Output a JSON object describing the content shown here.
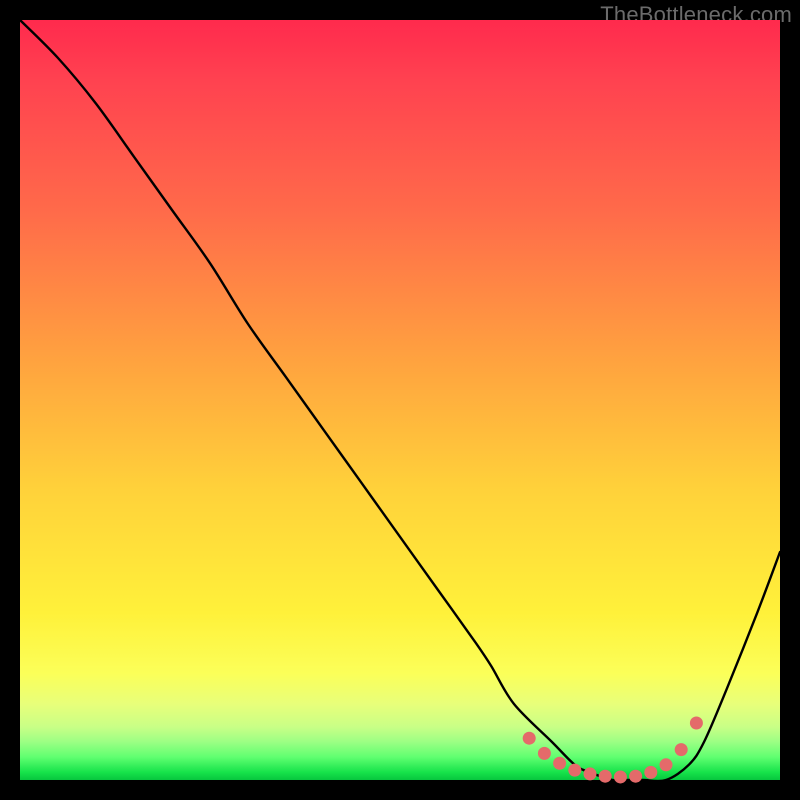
{
  "watermark": "TheBottleneck.com",
  "colors": {
    "curve": "#000000",
    "dots": "#e46a6a",
    "frame": "#000000"
  },
  "chart_data": {
    "type": "line",
    "title": "",
    "xlabel": "",
    "ylabel": "",
    "xlim": [
      0,
      100
    ],
    "ylim": [
      0,
      100
    ],
    "grid": false,
    "legend": false,
    "series": [
      {
        "name": "bottleneck-curve",
        "x": [
          0,
          5,
          10,
          15,
          20,
          25,
          30,
          35,
          40,
          45,
          50,
          55,
          60,
          62,
          65,
          70,
          73,
          75,
          78,
          80,
          82,
          85,
          88,
          90,
          93,
          97,
          100
        ],
        "y": [
          100,
          95,
          89,
          82,
          75,
          68,
          60,
          53,
          46,
          39,
          32,
          25,
          18,
          15,
          10,
          5,
          2,
          1,
          0,
          0,
          0,
          0,
          2,
          5,
          12,
          22,
          30
        ]
      }
    ],
    "highlight_points": {
      "name": "optimal-range-dots",
      "x": [
        67,
        69,
        71,
        73,
        75,
        77,
        79,
        81,
        83,
        85,
        87,
        89
      ],
      "y": [
        5.5,
        3.5,
        2.2,
        1.3,
        0.8,
        0.5,
        0.4,
        0.5,
        1.0,
        2.0,
        4.0,
        7.5
      ]
    }
  }
}
